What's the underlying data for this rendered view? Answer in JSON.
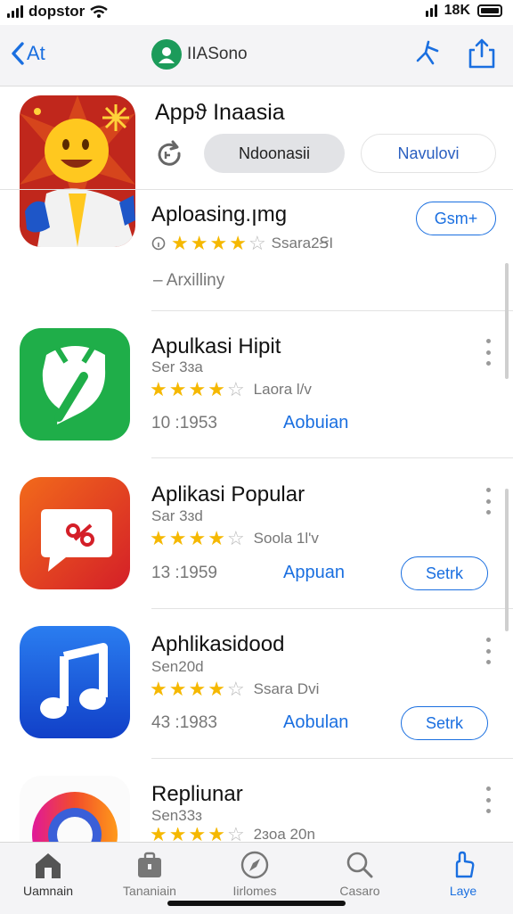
{
  "status_bar": {
    "carrier": "dopstor",
    "battery_label": "18K"
  },
  "nav": {
    "back_label": "At",
    "title": "IIASono"
  },
  "featured": {
    "title": "Appϑ Inaasia",
    "chips": [
      "Ndoonasii",
      "Navulovi"
    ],
    "subtitle": "Aploasing.ꞁmg",
    "rating_text": "Ssara2ꞨI",
    "meta": "– Arxilliny",
    "get_label": "Gsm+",
    "stars_filled": 4
  },
  "apps": [
    {
      "name": "Apulkasi Hipit",
      "sub": "Ser 3ɜa",
      "stars_filled": 4,
      "rating_text": "Laora Ɩ/v",
      "version": "10 :1953",
      "link": "Aobuian",
      "button": ""
    },
    {
      "name": "Aplikasi Popular",
      "sub": "Sar 3ɜd",
      "stars_filled": 4,
      "rating_text": "Soola 1l'v",
      "version": "13 :1959",
      "link": "Appuan",
      "button": "Setrk"
    },
    {
      "name": "Aphlikasidood",
      "sub": "Sen20d",
      "stars_filled": 4,
      "rating_text": "Ssara Dvi",
      "version": "43 :1983",
      "link": "Aobulan",
      "button": "Setrk"
    },
    {
      "name": "Repliunar",
      "sub": "Sen33ɜ",
      "stars_filled": 4,
      "rating_text": "2ɜoa 20n",
      "version": "",
      "link": "",
      "button": ""
    }
  ],
  "tabs": [
    {
      "label": "Uamnain",
      "icon": "home-icon"
    },
    {
      "label": "Tananiain",
      "icon": "briefcase-icon"
    },
    {
      "label": "Iirlomes",
      "icon": "compass-icon"
    },
    {
      "label": "Casaro",
      "icon": "search-icon"
    },
    {
      "label": "Laye",
      "icon": "hand-icon"
    }
  ],
  "colors": {
    "accent": "#1a6fe0",
    "star": "#f5b800",
    "bar_bg": "#f4f4f6"
  }
}
